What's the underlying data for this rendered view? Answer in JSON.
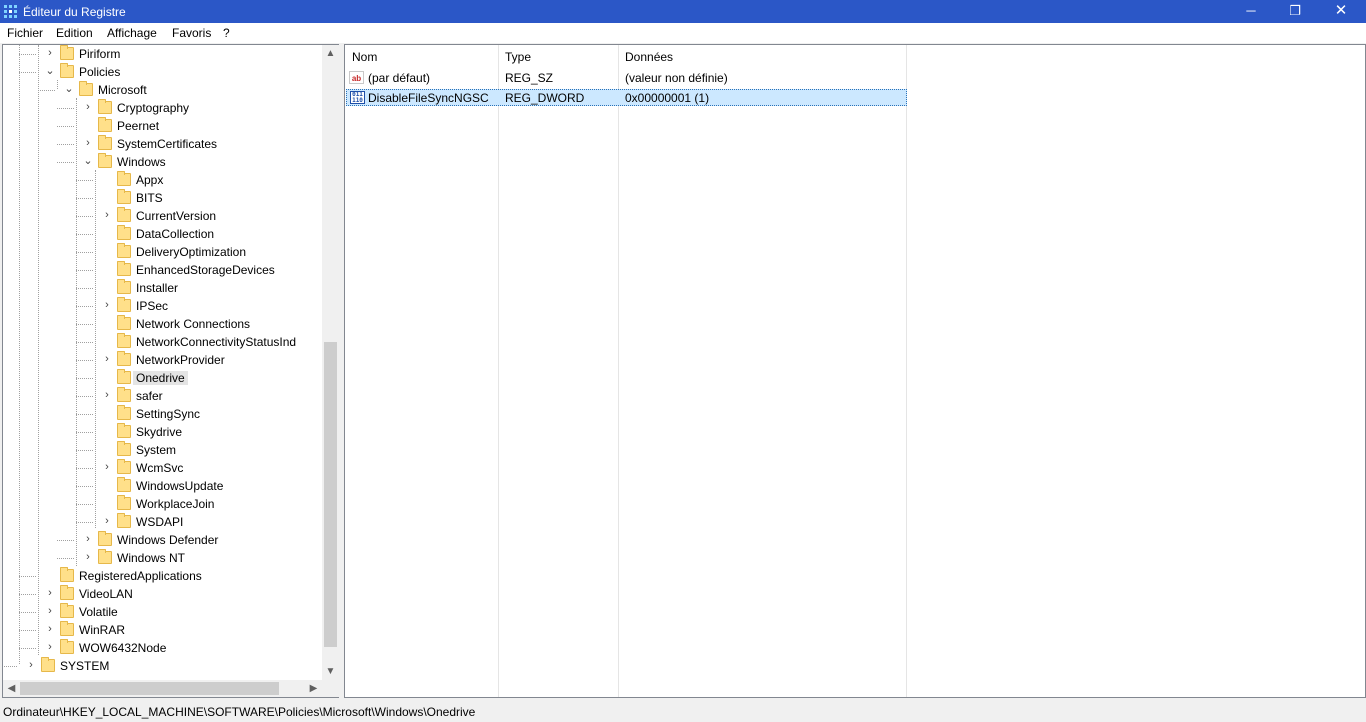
{
  "window": {
    "title": "Éditeur du Registre",
    "minimize": "─",
    "maximize": "❐",
    "close": "✕"
  },
  "menu": [
    "Fichier",
    "Edition",
    "Affichage",
    "Favoris",
    "?"
  ],
  "tree": {
    "expand_glyph": "›",
    "collapse_glyph": "⌄",
    "items": [
      {
        "label": "Piriform",
        "depth": 2,
        "toggle": "collapsed"
      },
      {
        "label": "Policies",
        "depth": 2,
        "toggle": "expanded"
      },
      {
        "label": "Microsoft",
        "depth": 3,
        "toggle": "expanded"
      },
      {
        "label": "Cryptography",
        "depth": 4,
        "toggle": "collapsed"
      },
      {
        "label": "Peernet",
        "depth": 4,
        "toggle": "none"
      },
      {
        "label": "SystemCertificates",
        "depth": 4,
        "toggle": "collapsed"
      },
      {
        "label": "Windows",
        "depth": 4,
        "toggle": "expanded"
      },
      {
        "label": "Appx",
        "depth": 5,
        "toggle": "none"
      },
      {
        "label": "BITS",
        "depth": 5,
        "toggle": "none"
      },
      {
        "label": "CurrentVersion",
        "depth": 5,
        "toggle": "collapsed"
      },
      {
        "label": "DataCollection",
        "depth": 5,
        "toggle": "none"
      },
      {
        "label": "DeliveryOptimization",
        "depth": 5,
        "toggle": "none"
      },
      {
        "label": "EnhancedStorageDevices",
        "depth": 5,
        "toggle": "none"
      },
      {
        "label": "Installer",
        "depth": 5,
        "toggle": "none"
      },
      {
        "label": "IPSec",
        "depth": 5,
        "toggle": "collapsed"
      },
      {
        "label": "Network Connections",
        "depth": 5,
        "toggle": "none"
      },
      {
        "label": "NetworkConnectivityStatusInd",
        "depth": 5,
        "toggle": "none"
      },
      {
        "label": "NetworkProvider",
        "depth": 5,
        "toggle": "collapsed"
      },
      {
        "label": "Onedrive",
        "depth": 5,
        "toggle": "none",
        "selected": true
      },
      {
        "label": "safer",
        "depth": 5,
        "toggle": "collapsed"
      },
      {
        "label": "SettingSync",
        "depth": 5,
        "toggle": "none"
      },
      {
        "label": "Skydrive",
        "depth": 5,
        "toggle": "none"
      },
      {
        "label": "System",
        "depth": 5,
        "toggle": "none"
      },
      {
        "label": "WcmSvc",
        "depth": 5,
        "toggle": "collapsed"
      },
      {
        "label": "WindowsUpdate",
        "depth": 5,
        "toggle": "none"
      },
      {
        "label": "WorkplaceJoin",
        "depth": 5,
        "toggle": "none"
      },
      {
        "label": "WSDAPI",
        "depth": 5,
        "toggle": "collapsed"
      },
      {
        "label": "Windows Defender",
        "depth": 4,
        "toggle": "collapsed"
      },
      {
        "label": "Windows NT",
        "depth": 4,
        "toggle": "collapsed"
      },
      {
        "label": "RegisteredApplications",
        "depth": 2,
        "toggle": "none"
      },
      {
        "label": "VideoLAN",
        "depth": 2,
        "toggle": "collapsed"
      },
      {
        "label": "Volatile",
        "depth": 2,
        "toggle": "collapsed"
      },
      {
        "label": "WinRAR",
        "depth": 2,
        "toggle": "collapsed"
      },
      {
        "label": "WOW6432Node",
        "depth": 2,
        "toggle": "collapsed"
      },
      {
        "label": "SYSTEM",
        "depth": 1,
        "toggle": "collapsed"
      }
    ]
  },
  "list": {
    "columns": [
      "Nom",
      "Type",
      "Données"
    ],
    "rows": [
      {
        "icon": "ab",
        "icon_name": "string-value-icon",
        "name": "(par défaut)",
        "type": "REG_SZ",
        "data": "(valeur non définie)",
        "selected": false
      },
      {
        "icon": "011\n110",
        "icon_name": "binary-value-icon",
        "name": "DisableFileSyncNGSC",
        "type": "REG_DWORD",
        "data": "0x00000001 (1)",
        "selected": true
      }
    ]
  },
  "status": {
    "path": "Ordinateur\\HKEY_LOCAL_MACHINE\\SOFTWARE\\Policies\\Microsoft\\Windows\\Onedrive"
  }
}
